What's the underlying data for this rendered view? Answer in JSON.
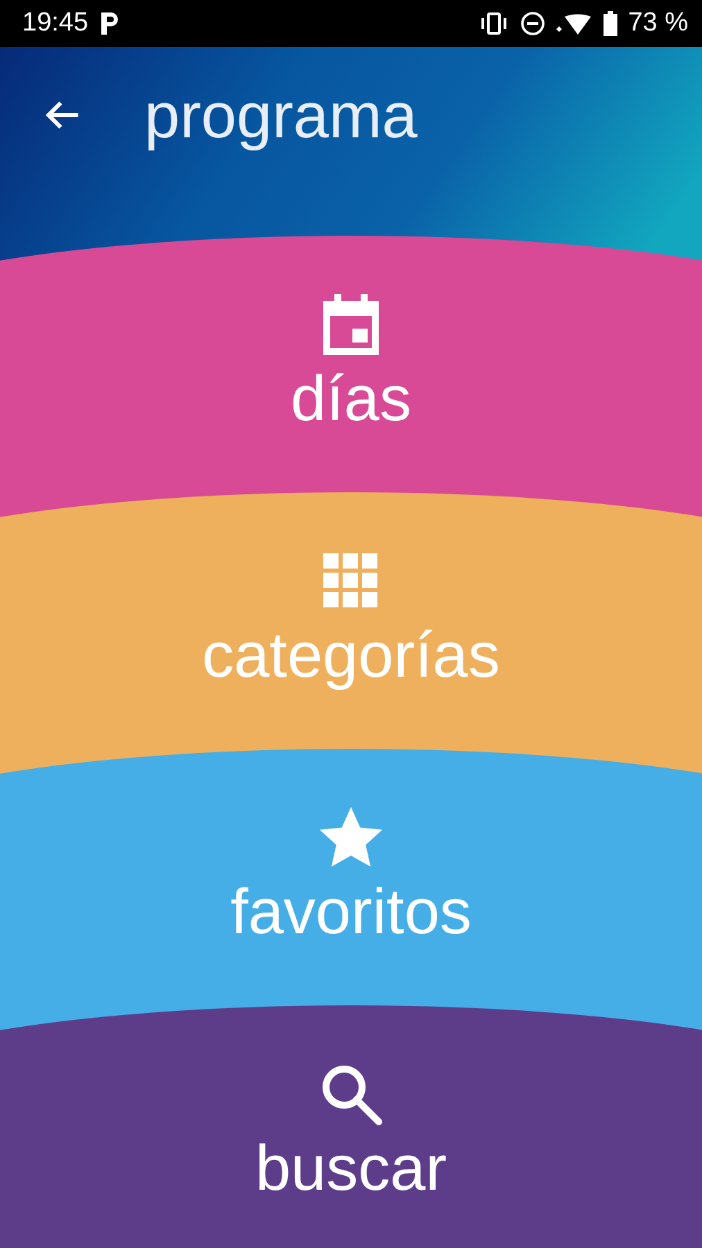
{
  "status_bar": {
    "time": "19:45",
    "battery": "73 %"
  },
  "header": {
    "title": "programa"
  },
  "menu": [
    {
      "label": "días",
      "kind": "calendar",
      "color": "#d84a96"
    },
    {
      "label": "categorías",
      "kind": "grid",
      "color": "#eeb05c"
    },
    {
      "label": "favoritos",
      "kind": "star",
      "color": "#45aee6"
    },
    {
      "label": "buscar",
      "kind": "search",
      "color": "#5d3d8a"
    }
  ]
}
